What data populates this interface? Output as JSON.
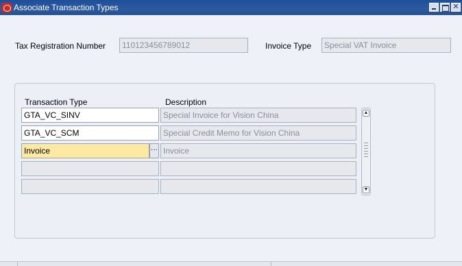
{
  "window": {
    "title": "Associate Transaction Types",
    "logo_icon": "oracle-logo-icon",
    "controls": {
      "minimize_icon": "minimize-icon",
      "maximize_icon": "maximize-icon",
      "close_glyph": "✕"
    }
  },
  "header": {
    "tax_registration_label": "Tax Registration Number",
    "tax_registration_value": "110123456789012",
    "invoice_type_label": "Invoice Type",
    "invoice_type_value": "Special VAT Invoice"
  },
  "table": {
    "columns": [
      "Transaction Type",
      "Description"
    ],
    "rows": [
      {
        "transaction_type": "GTA_VC_SINV",
        "description": "Special Invoice for Vision China"
      },
      {
        "transaction_type": "GTA_VC_SCM",
        "description": "Special Credit Memo for Vision China"
      },
      {
        "transaction_type": "Invoice",
        "description": "Invoice"
      },
      {
        "transaction_type": "",
        "description": ""
      },
      {
        "transaction_type": "",
        "description": ""
      }
    ],
    "lov_button_glyph": "···",
    "scroll_up_glyph": "▲",
    "scroll_down_glyph": "▼"
  },
  "colors": {
    "titlebar": "#2c5aa0",
    "active_field": "#fce9a2",
    "readonly_field": "#e6e8ed",
    "background": "#eff1f8"
  }
}
